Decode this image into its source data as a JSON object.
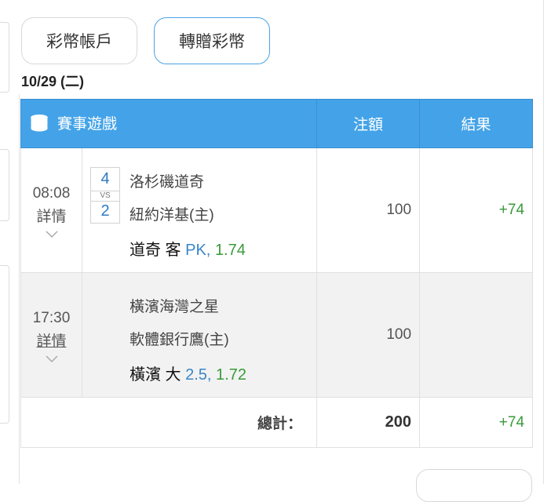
{
  "tabs": {
    "account": "彩幣帳戶",
    "transfer": "轉贈彩幣"
  },
  "date": "10/29 (二)",
  "table": {
    "headers": {
      "game": "賽事遊戲",
      "stake": "注額",
      "result": "結果"
    },
    "rows": [
      {
        "time": "08:08",
        "detail": "詳情",
        "home_score": "4",
        "vs": "VS",
        "away_score": "2",
        "team1": "洛杉磯道奇",
        "team2": "紐約洋基(主)",
        "bet_pick": "道奇 客",
        "bet_line": "PK,",
        "bet_odds": "1.74",
        "stake": "100",
        "result": "+74"
      },
      {
        "time": "17:30",
        "detail": "詳情",
        "team1": "橫濱海灣之星",
        "team2": "軟體銀行鷹(主)",
        "bet_pick": "橫濱 大",
        "bet_line": "2.5,",
        "bet_odds": "1.72",
        "stake": "100",
        "result": ""
      }
    ],
    "total": {
      "label": "總計：",
      "stake": "200",
      "result": "+74"
    }
  },
  "colors": {
    "header_bg": "#44a3e8",
    "win": "#3a9a3a",
    "link_blue": "#3a86c8"
  },
  "icons": {
    "header": "coin-stack-icon",
    "expand": "chevron-down-icon"
  }
}
